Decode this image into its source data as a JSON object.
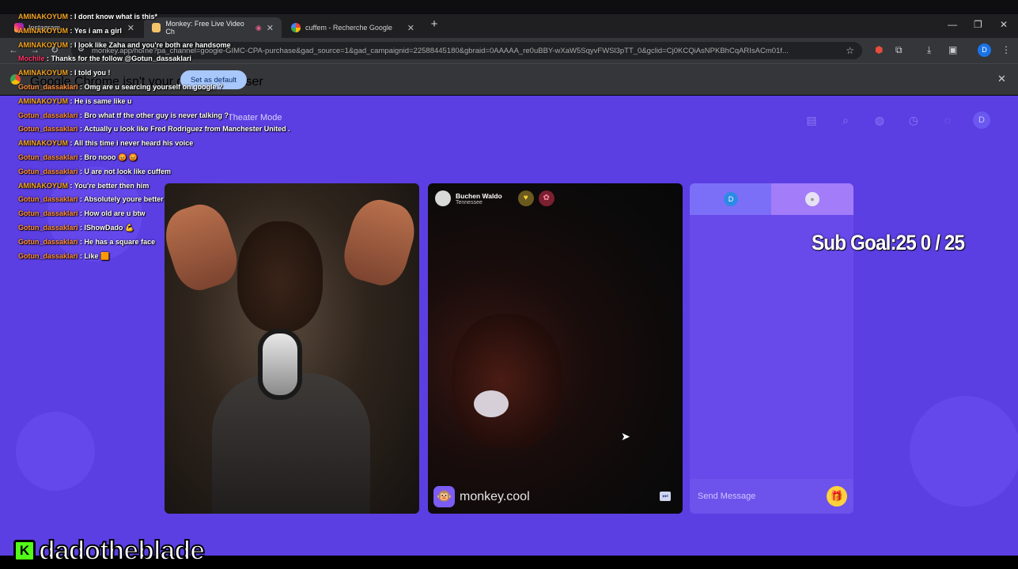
{
  "browser": {
    "tabs": [
      {
        "label": "Instagram",
        "active": false
      },
      {
        "label": "Monkey: Free Live Video Ch",
        "active": true
      },
      {
        "label": "cuffem - Recherche Google",
        "active": false
      }
    ],
    "new_tab": "+",
    "url": "monkey.app/home?pa_channel=google-GIMC-CPA-purchase&gad_source=1&gad_campaignid=22588445180&gbraid=0AAAAA_re0uBBY-wXaW5SqyvFWSl3pTT_0&gclid=Cj0KCQiAsNPKBhCqARIsACm01f...",
    "infobar_message": "Google Chrome isn't your default browser",
    "set_default_label": "Set as default",
    "profile_initial": "D"
  },
  "page": {
    "theater_mode": "Theater Mode",
    "header_avatar": "D",
    "remote_user": {
      "name": "Buchen Waldo",
      "location": "Tennessee"
    },
    "watermark": "monkey.cool",
    "panel_tab_initial": "D",
    "send_placeholder": "Send Message",
    "sub_goal": "Sub Goal:25  0 / 25"
  },
  "chat": [
    {
      "user": "AMINAKOYUM",
      "text": "I dont know what is this*",
      "cls": "u-amina"
    },
    {
      "user": "AMINAKOYUM",
      "text": "Yes i am a girl",
      "cls": "u-amina"
    },
    {
      "user": "AMINAKOYUM",
      "text": "I look like Zaha and you're both are handsome",
      "cls": "u-amina"
    },
    {
      "user": "Mochile",
      "text": "Thanks for the follow @Gotun_dassaklari",
      "cls": "u-mochile"
    },
    {
      "user": "AMINAKOYUM",
      "text": "I told you !",
      "cls": "u-amina"
    },
    {
      "user": "Gotun_dassaklari",
      "text": "Omg are u searcing yourself on google ?",
      "cls": "u-gotun"
    },
    {
      "user": "AMINAKOYUM",
      "text": "He is same like u",
      "cls": "u-amina"
    },
    {
      "user": "Gotun_dassaklari",
      "text": "Bro what tf the other guy is never talking ?",
      "cls": "u-gotun"
    },
    {
      "user": "Gotun_dassaklari",
      "text": "Actually u look like Fred Rodriguez from Manchester United .",
      "cls": "u-gotun"
    },
    {
      "user": "AMINAKOYUM",
      "text": "All this time i never heard his voice",
      "cls": "u-amina"
    },
    {
      "user": "Gotun_dassaklari",
      "text": "Bro nooo 😡 😡",
      "cls": "u-gotun"
    },
    {
      "user": "Gotun_dassaklari",
      "text": "U are not look like cuffem",
      "cls": "u-gotun"
    },
    {
      "user": "AMINAKOYUM",
      "text": "You're better then him",
      "cls": "u-amina"
    },
    {
      "user": "Gotun_dassaklari",
      "text": "Absolutely youre better",
      "cls": "u-gotun"
    },
    {
      "user": "Gotun_dassaklari",
      "text": "How old are u btw",
      "cls": "u-gotun"
    },
    {
      "user": "Gotun_dassaklari",
      "text": "IShowDado 💪",
      "cls": "u-gotun"
    },
    {
      "user": "Gotun_dassaklari",
      "text": "He has a square face",
      "cls": "u-gotun"
    },
    {
      "user": "Gotun_dassaklari",
      "text": "Like 🟧",
      "cls": "u-gotun"
    }
  ],
  "streamer": {
    "platform_icon": "K",
    "name": "dadotheblade"
  },
  "colors": {
    "page_bg": "#5b3fe2",
    "accent_gold": "#ffd23b",
    "kick_green": "#53fc18"
  }
}
